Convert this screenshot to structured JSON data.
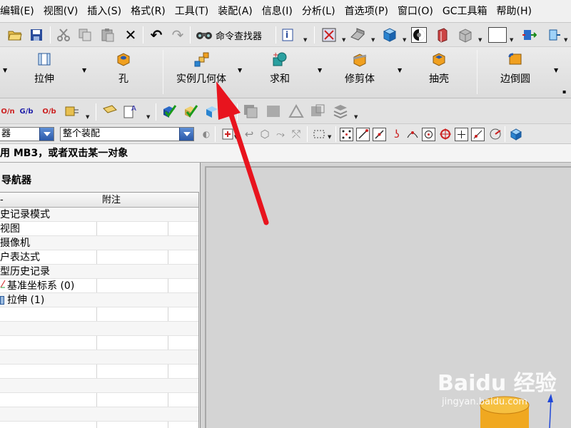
{
  "menu": [
    "编辑(E)",
    "视图(V)",
    "插入(S)",
    "格式(R)",
    "工具(T)",
    "装配(A)",
    "信息(I)",
    "分析(L)",
    "首选项(P)",
    "窗口(O)",
    "GC工具箱",
    "帮助(H)"
  ],
  "toolbar": {
    "command_finder": "命令查找器"
  },
  "ribbon": {
    "extrude": "拉伸",
    "hole": "孔",
    "instance_geometry": "实例几何体",
    "unite": "求和",
    "trim_body": "修剪体",
    "shell": "抽壳",
    "edge_blend": "边倒圆"
  },
  "selbar": {
    "filter_value": "器",
    "scope_value": "整个装配"
  },
  "cue": "用 MB3，或者双击某一对象",
  "navigator": {
    "title": "导航器",
    "col_name": "-",
    "col_comment": "附注",
    "rows": [
      "史记录模式",
      "视图",
      "摄像机",
      "户表达式",
      "型历史记录",
      "基准坐标系 (0)",
      "拉伸 (1)"
    ]
  },
  "watermark": {
    "logo": "Baidu 经验",
    "url": "jingyan.baidu.com"
  },
  "colors": {
    "arrow": "#e8141e",
    "cylinder": "#f0a820",
    "axis": "#2048d8"
  }
}
